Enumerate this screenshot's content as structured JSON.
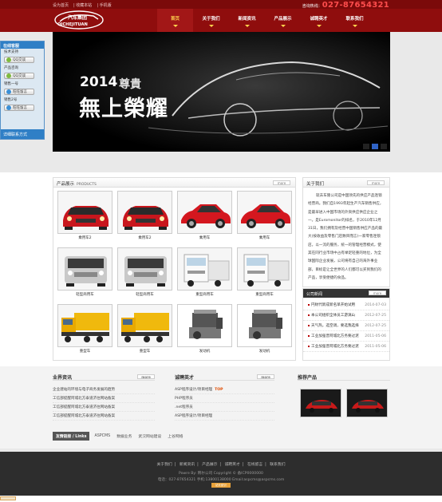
{
  "header": {
    "links": [
      "设为首页",
      "收藏本站",
      "手机版"
    ],
    "hotline_label": "咨询热线：",
    "hotline_number": "027-87654321",
    "logo_text_top": "汽车集团",
    "logo_text_bottom": "QICHEJITUAN"
  },
  "nav": [
    {
      "label": "首页",
      "active": true
    },
    {
      "label": "关于我们",
      "active": false
    },
    {
      "label": "新闻资讯",
      "active": false
    },
    {
      "label": "产品展示",
      "active": false
    },
    {
      "label": "诚聘英才",
      "active": false
    },
    {
      "label": "联系我们",
      "active": false
    }
  ],
  "banner": {
    "year": "2014",
    "slogan_small": "尊貴",
    "slogan_big": "無上榮耀",
    "slides": 3,
    "active_slide": 1
  },
  "float_service": {
    "title": "在线客服",
    "groups": [
      {
        "label": "技术支持",
        "button": "QQ交谈"
      },
      {
        "label": "产品咨询",
        "button": "QQ交谈"
      },
      {
        "label": "销售一号",
        "button": "旺旺留言"
      },
      {
        "label": "销售2号",
        "button": "旺旺留言"
      }
    ],
    "bottom": "详细联系方式"
  },
  "products": {
    "title": "产品展示",
    "subtitle": "PRODUCTS",
    "more": "more",
    "items": [
      {
        "name": "乘用车2",
        "kind": "car-red"
      },
      {
        "name": "乘用车2",
        "kind": "car-red"
      },
      {
        "name": "乘用车",
        "kind": "car-red-side"
      },
      {
        "name": "乘用车",
        "kind": "car-red-side"
      },
      {
        "name": "轻型商用车",
        "kind": "van-silver"
      },
      {
        "name": "轻型商用车",
        "kind": "van-silver"
      },
      {
        "name": "重型商用车",
        "kind": "truck-white"
      },
      {
        "name": "重型商用车",
        "kind": "truck-white"
      },
      {
        "name": "重型车",
        "kind": "truck-yellow"
      },
      {
        "name": "重型车",
        "kind": "truck-yellow"
      },
      {
        "name": "发动机",
        "kind": "engine"
      },
      {
        "name": "发动机",
        "kind": "engine"
      }
    ]
  },
  "about": {
    "title": "关于我们",
    "more": "more",
    "text": "就去车隆公司是中国领先的供应产品连锁经营商。我们自1993年起生产汽车销售供应，是最早进入中国市场的外资供应供应企业之一。是Euromonitor的排名，于2010年12月31日，我们拥有及经营中国销售供应产品的最大(按收益及零售门店数目而言)一家零售连锁店。以一流的服务，统一的管理经营模式，使其在同行业市场中占有举足轻重的地位，为全球国际企业发展，公司将有自己的海外事业部，目标是让全世界的人们都可以买到我们的产品，享受便捷的食品。"
  },
  "news_panel": {
    "title": "公司新闻",
    "more": "more",
    "items": [
      {
        "title": "円财代新成新名单开始试用",
        "date": "2014-07-03"
      },
      {
        "title": "本公司组织全体员工游漓山",
        "date": "2012-07-25"
      },
      {
        "title": "天气热，选空调，要选我选择",
        "date": "2012-07-25"
      },
      {
        "title": "工业加强晋阿城北方务要过泥",
        "date": "2011-05-06"
      },
      {
        "title": "工业加强晋阿城北方务要过泥",
        "date": "2011-05-06"
      }
    ]
  },
  "industry": {
    "title": "业界资讯",
    "more": "more",
    "items": [
      "企业建站的环境与电子商务发展的趋势",
      "工信部提醒阿城北方泰道济往网站备案",
      "工信部提醒阿城北方泰道济往网站备案",
      "工信部提醒阿城北方泰道济往网站备案"
    ]
  },
  "jobs": {
    "title": "诚聘英才",
    "more": "more",
    "items": [
      {
        "title": "ASP程序设计/项目经理",
        "tag": "TOP"
      },
      {
        "title": "PHP程序员",
        "tag": ""
      },
      {
        "title": ".net程序员",
        "tag": ""
      },
      {
        "title": "ASP程序设计/项目经理",
        "tag": ""
      }
    ]
  },
  "recommend": {
    "title": "推荐产品"
  },
  "links": {
    "title": "友情链接 / Links",
    "items": [
      "ASPCMS",
      "数据业务",
      "武汉网站建设",
      "上谷网络"
    ]
  },
  "footer": {
    "nav": [
      "关于我们",
      "新闻资讯",
      "产品展示",
      "诚聘英才",
      "在线留言",
      "联系我们"
    ],
    "powered": "Powre By: 韩尔公司 Copyright © 备ICP0000000",
    "contact": "电话：027-87654321 手机:13800138000 Email:aspcms@aspcms.com",
    "badge": "站长统计"
  },
  "colors": {
    "brand_red": "#8f0d0d",
    "accent_yellow": "#ffd34d",
    "hotline_red": "#ff4d4d"
  }
}
